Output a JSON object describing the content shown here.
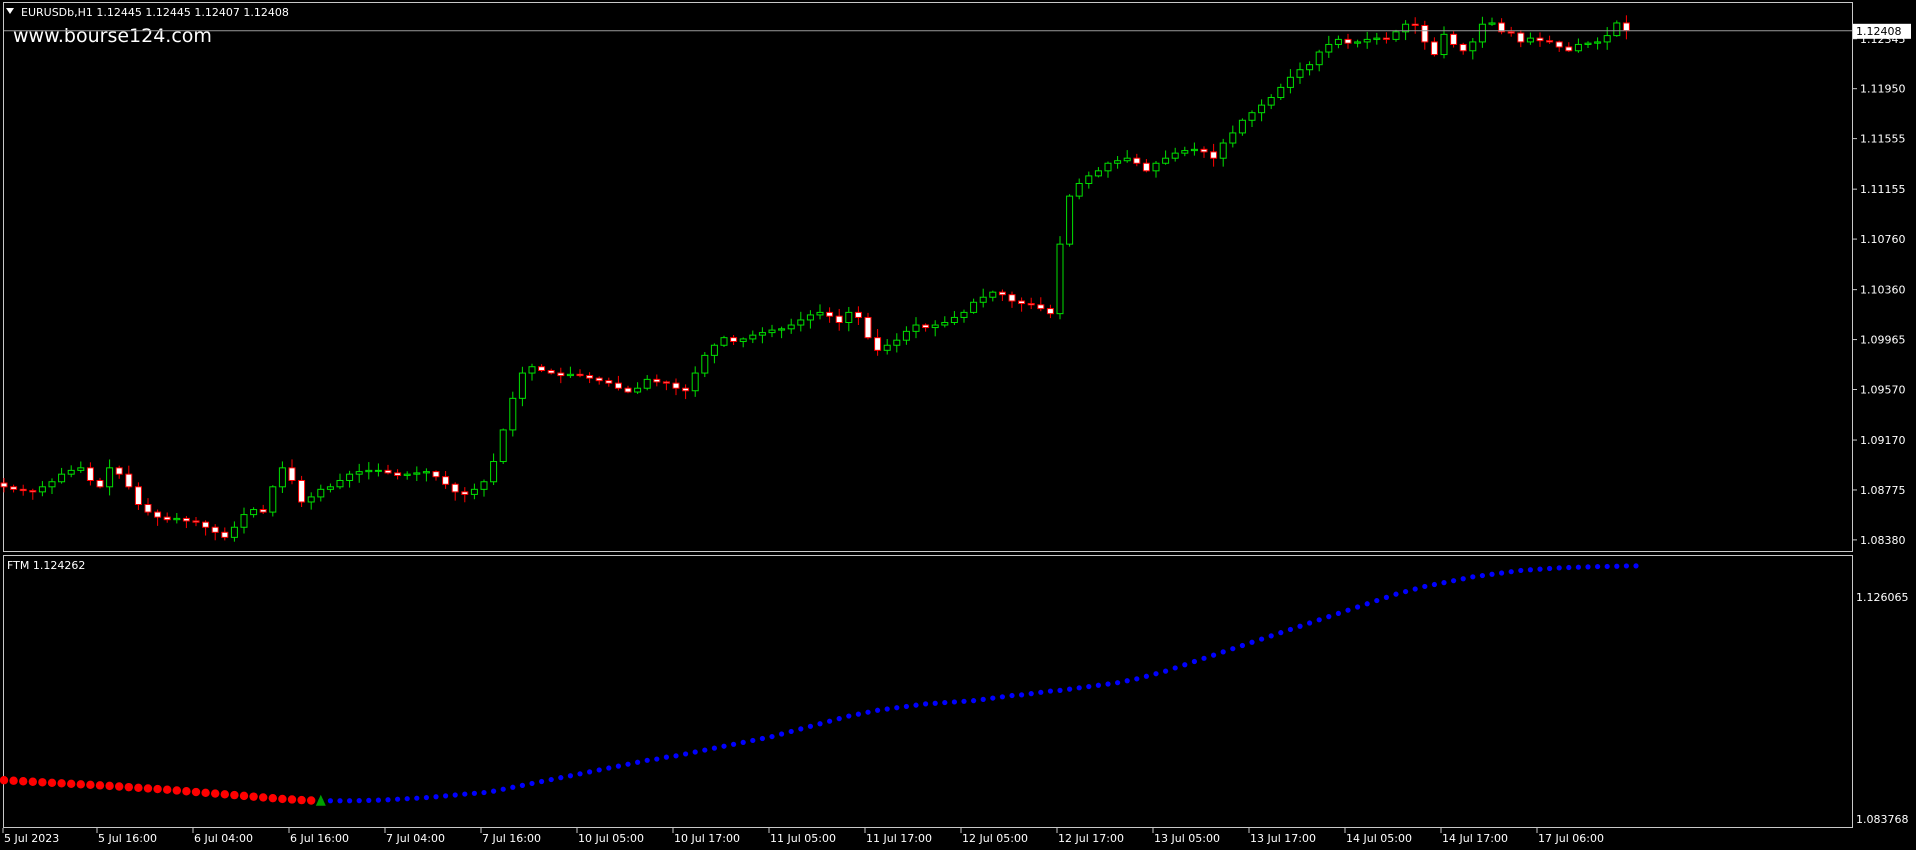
{
  "main_panel": {
    "header": "EURUSDb,H1  1.12445 1.12445 1.12407 1.12408",
    "watermark": "www.bourse124.com",
    "current_price": "1.12408",
    "y_ticks": [
      "1.12345",
      "1.11950",
      "1.11555",
      "1.11155",
      "1.10760",
      "1.10360",
      "1.09965",
      "1.09570",
      "1.09170",
      "1.08775",
      "1.08380"
    ]
  },
  "indicator_panel": {
    "header": "FTM 1.124262",
    "y_top_label": "1.126065",
    "y_bottom_label": "1.083768"
  },
  "x_ticks": [
    "5 Jul 2023",
    "5 Jul 16:00",
    "6 Jul 04:00",
    "6 Jul 16:00",
    "7 Jul 04:00",
    "7 Jul 16:00",
    "10 Jul 05:00",
    "10 Jul 17:00",
    "11 Jul 05:00",
    "11 Jul 17:00",
    "12 Jul 05:00",
    "12 Jul 17:00",
    "13 Jul 05:00",
    "13 Jul 17:00",
    "14 Jul 05:00",
    "14 Jul 17:00",
    "17 Jul 06:00"
  ],
  "colors": {
    "background": "#000000",
    "frame": "#c8c8c8",
    "text": "#ffffff",
    "bull": "#00e000",
    "bear": "#ff0000",
    "ftm_down": "#ff0000",
    "ftm_up": "#0000ff",
    "signal_arrow": "#00a000"
  },
  "chart_data": [
    {
      "type": "candlestick",
      "title": "EURUSDb,H1",
      "ylim": [
        1.083,
        1.1262
      ],
      "last_price": 1.12408,
      "close": [
        1.088,
        1.0878,
        1.0877,
        1.0876,
        1.088,
        1.0884,
        1.089,
        1.0893,
        1.0895,
        1.0885,
        1.088,
        1.0895,
        1.089,
        1.088,
        1.0866,
        1.086,
        1.0856,
        1.0854,
        1.0855,
        1.0853,
        1.0852,
        1.0848,
        1.0844,
        1.084,
        1.0848,
        1.0858,
        1.0862,
        1.086,
        1.088,
        1.0895,
        1.0885,
        1.0868,
        1.0872,
        1.0878,
        1.088,
        1.0885,
        1.089,
        1.0892,
        1.0893,
        1.0893,
        1.0891,
        1.0889,
        1.089,
        1.0891,
        1.0892,
        1.0888,
        1.0882,
        1.0876,
        1.0874,
        1.0878,
        1.0884,
        1.09,
        1.0925,
        1.095,
        1.097,
        1.0975,
        1.0972,
        1.097,
        1.0968,
        1.0969,
        1.0968,
        1.0966,
        1.0964,
        1.0962,
        1.0958,
        1.0955,
        1.0958,
        1.0965,
        1.0963,
        1.0962,
        1.0958,
        1.0956,
        1.097,
        1.0984,
        1.0992,
        1.0998,
        1.0995,
        1.0997,
        1.1,
        1.1002,
        1.1004,
        1.1005,
        1.1008,
        1.1012,
        1.1016,
        1.1018,
        1.1015,
        1.101,
        1.1018,
        1.1014,
        1.0998,
        1.0988,
        1.0992,
        1.0996,
        1.1003,
        1.1008,
        1.1006,
        1.1008,
        1.101,
        1.1014,
        1.1018,
        1.1026,
        1.103,
        1.1034,
        1.1032,
        1.1027,
        1.1025,
        1.1024,
        1.1021,
        1.1017,
        1.1072,
        1.111,
        1.112,
        1.1126,
        1.113,
        1.1136,
        1.1138,
        1.114,
        1.1136,
        1.113,
        1.1136,
        1.114,
        1.1144,
        1.1146,
        1.1147,
        1.1145,
        1.114,
        1.1152,
        1.116,
        1.117,
        1.1176,
        1.1182,
        1.1188,
        1.1196,
        1.1204,
        1.121,
        1.1214,
        1.1224,
        1.123,
        1.1234,
        1.1231,
        1.1232,
        1.1234,
        1.1235,
        1.1234,
        1.124,
        1.1246,
        1.1245,
        1.1232,
        1.1222,
        1.1238,
        1.123,
        1.1225,
        1.1232,
        1.1246,
        1.1247,
        1.124,
        1.1239,
        1.1232,
        1.1235,
        1.1233,
        1.1232,
        1.1228,
        1.1225,
        1.123,
        1.1231,
        1.1232,
        1.1237,
        1.1247,
        1.1241
      ]
    },
    {
      "type": "line",
      "title": "FTM",
      "last_value": 1.124262,
      "ylim": [
        1.083768,
        1.126065
      ],
      "signal": "up arrow at bar 33 (6 Jul 16:00)",
      "values": [
        1.093,
        1.09292,
        1.09284,
        1.09276,
        1.09268,
        1.0926,
        1.09252,
        1.09244,
        1.09236,
        1.09228,
        1.0922,
        1.09212,
        1.09202,
        1.09192,
        1.09182,
        1.09172,
        1.09162,
        1.09152,
        1.0914,
        1.09128,
        1.09116,
        1.09104,
        1.09092,
        1.0908,
        1.09068,
        1.09056,
        1.09044,
        1.09032,
        1.0902,
        1.09008,
        1.09,
        1.0899,
        1.08984,
        1.0898,
        1.0898,
        1.0898,
        1.0898,
        1.08982,
        1.08986,
        1.0899,
        1.08996,
        1.09004,
        1.09012,
        1.0902,
        1.0903,
        1.09042,
        1.09056,
        1.0907,
        1.09084,
        1.09096,
        1.09108,
        1.0913,
        1.0916,
        1.0919,
        1.0922,
        1.0925,
        1.0928,
        1.0931,
        1.0934,
        1.0937,
        1.094,
        1.0943,
        1.0946,
        1.0949,
        1.0952,
        1.0955,
        1.0958,
        1.0961,
        1.0963,
        1.0966,
        1.0968,
        1.0971,
        1.0974,
        1.0977,
        1.098,
        1.0983,
        1.0986,
        1.0989,
        1.0992,
        1.0995,
        1.0998,
        1.1002,
        1.1006,
        1.101,
        1.1014,
        1.1018,
        1.1022,
        1.1026,
        1.103,
        1.1033,
        1.1036,
        1.1039,
        1.1041,
        1.1043,
        1.1045,
        1.1047,
        1.1049,
        1.105,
        1.1051,
        1.1052,
        1.1053,
        1.1054,
        1.1056,
        1.1058,
        1.106,
        1.1062,
        1.1063,
        1.1065,
        1.1067,
        1.1069,
        1.107,
        1.1072,
        1.1074,
        1.1076,
        1.1078,
        1.108,
        1.1082,
        1.1085,
        1.1088,
        1.1092,
        1.1096,
        1.11,
        1.1105,
        1.111,
        1.1115,
        1.112,
        1.1125,
        1.113,
        1.1135,
        1.114,
        1.1145,
        1.115,
        1.1155,
        1.116,
        1.1165,
        1.117,
        1.1175,
        1.118,
        1.1185,
        1.119,
        1.1195,
        1.12,
        1.1205,
        1.121,
        1.1215,
        1.122,
        1.1224,
        1.1228,
        1.1232,
        1.1235,
        1.1238,
        1.1241,
        1.1244,
        1.1247,
        1.1249,
        1.1251,
        1.1253,
        1.1255,
        1.1257,
        1.1258,
        1.1259,
        1.126,
        1.1261,
        1.12615,
        1.1262,
        1.12625,
        1.1263,
        1.12632,
        1.12635,
        1.1264,
        1.12641
      ]
    }
  ]
}
